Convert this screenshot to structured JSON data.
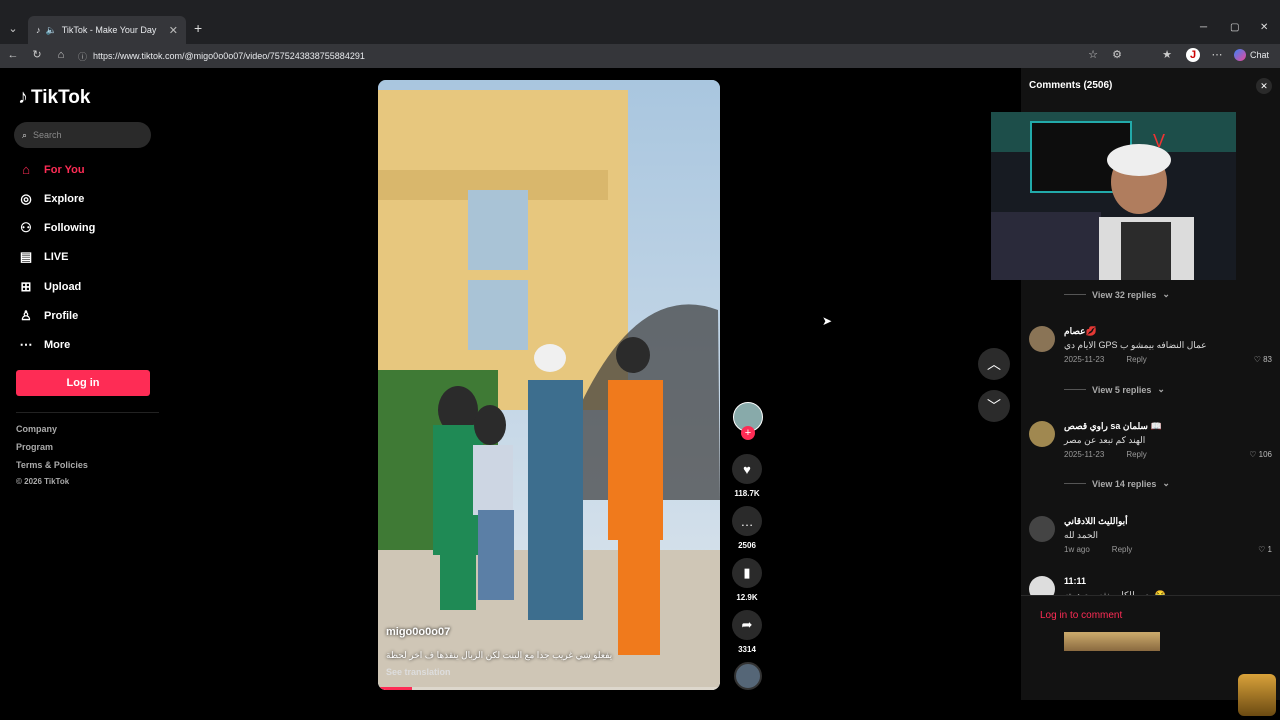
{
  "browser": {
    "tab_title": "TikTok - Make Your Day",
    "url": "https://www.tiktok.com/@migo0o0o07/video/7575243838755884291",
    "chat_label": "Chat",
    "profile_initial": "J"
  },
  "sidebar": {
    "logo": "TikTok",
    "search_placeholder": "Search",
    "items": [
      {
        "label": "For You",
        "icon": "home-icon"
      },
      {
        "label": "Explore",
        "icon": "compass-icon"
      },
      {
        "label": "Following",
        "icon": "following-icon"
      },
      {
        "label": "LIVE",
        "icon": "live-icon"
      },
      {
        "label": "Upload",
        "icon": "upload-icon"
      },
      {
        "label": "Profile",
        "icon": "profile-icon"
      },
      {
        "label": "More",
        "icon": "more-icon"
      }
    ],
    "login": "Log in",
    "footer": [
      "Company",
      "Program",
      "Terms & Policies",
      "© 2026 TikTok"
    ]
  },
  "video": {
    "author": "migo0o0o07",
    "caption": "يفعلو شي غريب جدا مع البنت لكن الزبال ينقذها ف اخر لحظة",
    "see_translation": "See translation",
    "progress": 0.1
  },
  "actions": {
    "likes": "118.7K",
    "comments": "2506",
    "saves": "12.9K",
    "shares": "3314"
  },
  "comments_panel": {
    "title": "Comments",
    "count": "(2506)",
    "view_replies": [
      "View 32 replies",
      "View 5 replies",
      "View 14 replies"
    ],
    "reply_label": "Reply",
    "items": [
      {
        "name": "عصام💋",
        "text": "الايام دي GPS عمال النضافه بيمشو ب",
        "date": "2025-11-23",
        "likes": "83"
      },
      {
        "name": "راوي قصص sa سلمان 📖",
        "text": "الهند كم تبعد عن مصر",
        "date": "2025-11-23",
        "likes": "106"
      },
      {
        "name": "أبوالليث اللادقاني",
        "text": "الحمد لله",
        "date": "1w ago",
        "likes": "1"
      },
      {
        "name": "11:11",
        "text": "بصو للكلب نفس صدمته 😂",
        "date": "",
        "likes": ""
      }
    ],
    "login_to_comment": "Log in to comment"
  },
  "colors": {
    "accent": "#fe2c55",
    "bg": "#000000",
    "panel": "#121212"
  }
}
